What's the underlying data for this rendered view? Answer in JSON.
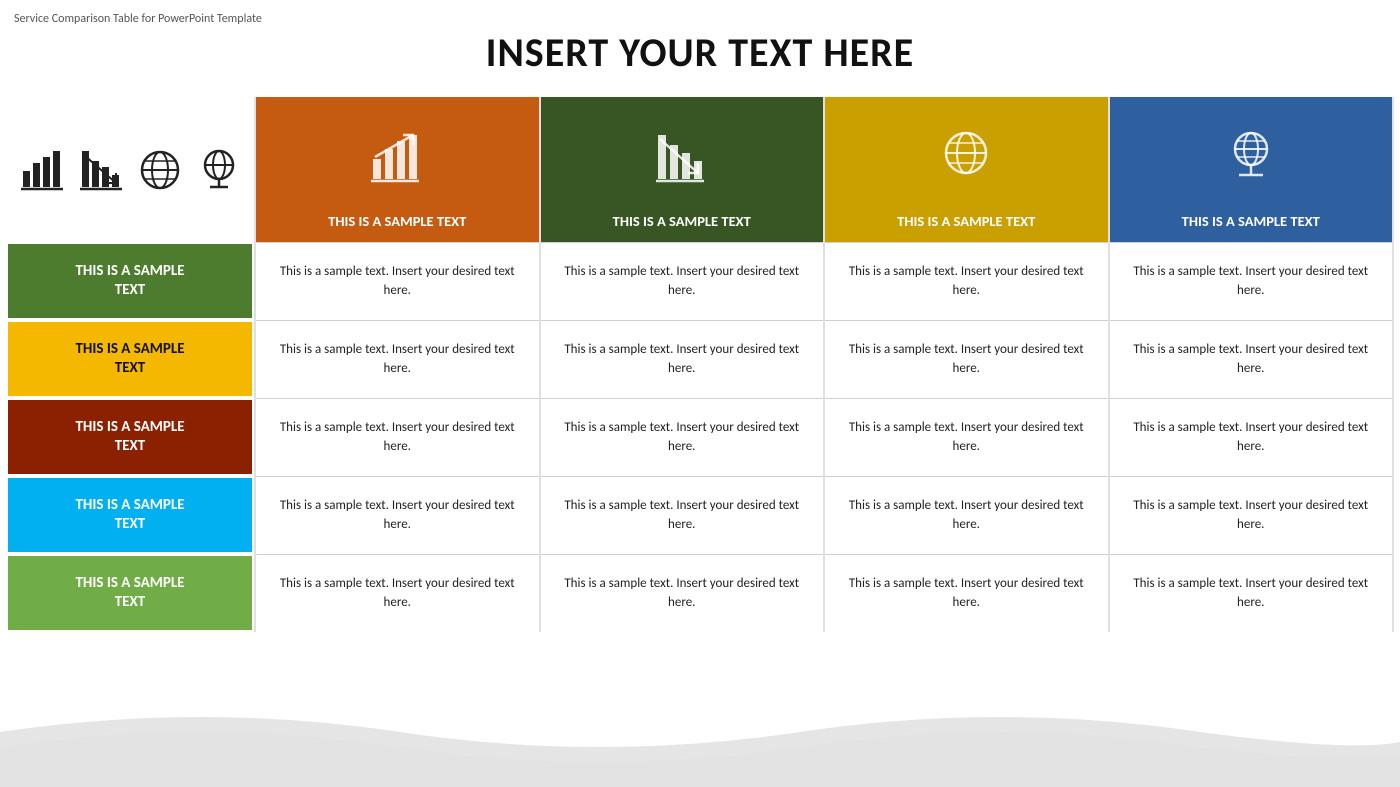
{
  "template_label": "Service Comparison Table for PowerPoint Template",
  "main_title": "INSERT YOUR TEXT HERE",
  "icon_block": {
    "icons": [
      "bar-chart-icon",
      "bar-chart-down-icon",
      "globe-icon",
      "globe-stand-icon"
    ]
  },
  "columns": [
    {
      "id": "col1",
      "color_class": "orange",
      "header_text": "THIS IS A SAMPLE TEXT",
      "icon": "bar-chart-up-icon"
    },
    {
      "id": "col2",
      "color_class": "dkgreen",
      "header_text": "THIS IS A SAMPLE TEXT",
      "icon": "bar-chart-down-icon"
    },
    {
      "id": "col3",
      "color_class": "gold",
      "header_text": "THIS IS A SAMPLE TEXT",
      "icon": "globe-icon"
    },
    {
      "id": "col4",
      "color_class": "blue",
      "header_text": "THIS IS A SAMPLE TEXT",
      "icon": "globe-stand-icon"
    }
  ],
  "rows": [
    {
      "label": "THIS IS A SAMPLE TEXT",
      "label_color": "green",
      "cells": [
        "This is a sample text. Insert your desired text here.",
        "This is a sample text. Insert your desired text here.",
        "This is a sample text. Insert your desired text here.",
        "This is a sample text. Insert your desired text here."
      ]
    },
    {
      "label": "THIS IS A SAMPLE TEXT",
      "label_color": "yellow",
      "cells": [
        "This is a sample text. Insert your desired text here.",
        "This is a sample text. Insert your desired text here.",
        "This is a sample text. Insert your desired text here.",
        "This is a sample text. Insert your desired text here."
      ]
    },
    {
      "label": "THIS IS A SAMPLE TEXT",
      "label_color": "red",
      "cells": [
        "This is a sample text. Insert your desired text here.",
        "This is a sample text. Insert your desired text here.",
        "This is a sample text. Insert your desired text here.",
        "This is a sample text. Insert your desired text here."
      ]
    },
    {
      "label": "THIS IS A SAMPLE TEXT",
      "label_color": "cyan",
      "cells": [
        "This is a sample text. Insert your desired text here.",
        "This is a sample text. Insert your desired text here.",
        "This is a sample text. Insert your desired text here.",
        "This is a sample text. Insert your desired text here."
      ]
    },
    {
      "label": "THIS IS A SAMPLE TEXT",
      "label_color": "lime",
      "cells": [
        "This is a sample text. Insert your desired text here.",
        "This is a sample text. Insert your desired text here.",
        "This is a sample text. Insert your desired text here.",
        "This is a sample text. Insert your desired text here."
      ]
    }
  ]
}
